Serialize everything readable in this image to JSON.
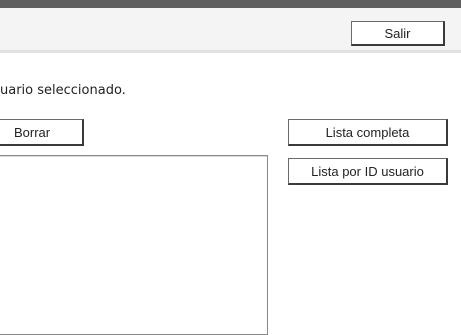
{
  "header": {
    "exit_label": "Salir"
  },
  "main": {
    "message": "uario seleccionado.",
    "delete_label": "Borrar",
    "full_list_label": "Lista completa",
    "list_by_id_label": "Lista por ID usuario"
  }
}
